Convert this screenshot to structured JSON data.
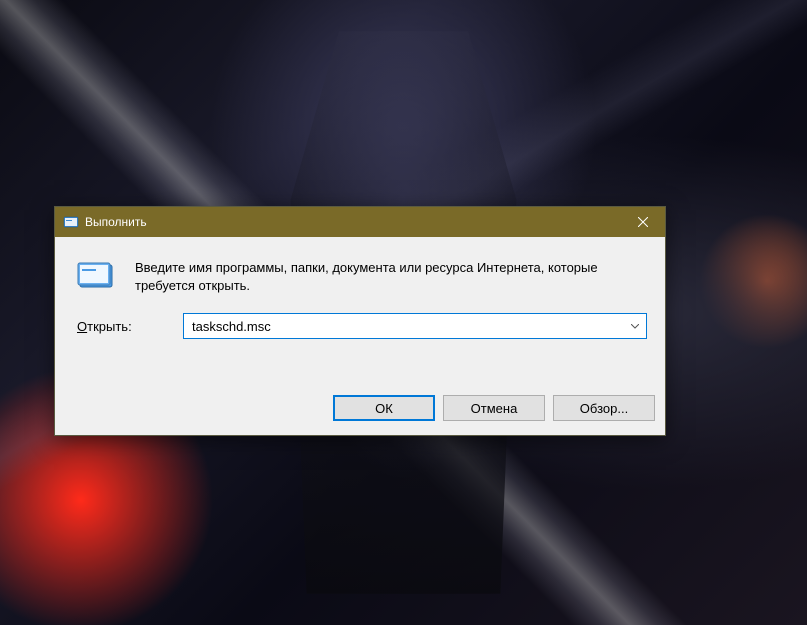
{
  "titlebar": {
    "title": "Выполнить"
  },
  "dialog": {
    "info_text": "Введите имя программы, папки, документа или ресурса Интернета, которые требуется открыть.",
    "open_label_prefix": "О",
    "open_label_rest": "ткрыть:",
    "input_value": "taskschd.msc"
  },
  "buttons": {
    "ok": "ОК",
    "cancel": "Отмена",
    "browse": "Обзор..."
  }
}
